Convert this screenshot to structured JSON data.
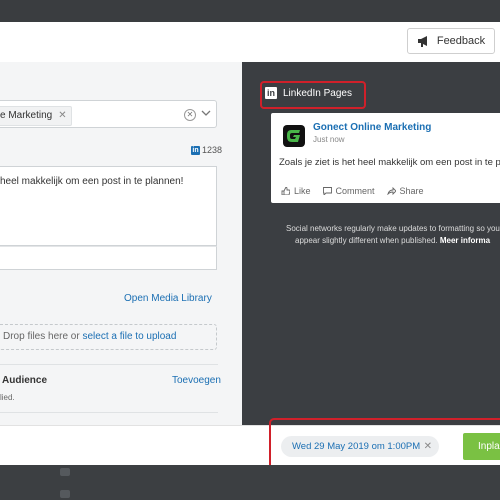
{
  "header": {
    "feedback_label": "Feedback"
  },
  "composer": {
    "selected_profile": "e Marketing",
    "linkedin_char_count": "1238",
    "post_text": "heel makkelijk om een post in te plannen!",
    "media_link": "Open Media Library",
    "dropzone_text": "Drop files here or ",
    "dropzone_link": "select a file to upload",
    "audience_label": "Audience",
    "audience_add": "Toevoegen",
    "audience_sub": "lied."
  },
  "preview": {
    "network_label": "LinkedIn Pages",
    "page_name": "Gonect Online Marketing",
    "time": "Just now",
    "text": "Zoals je ziet is het heel makkelijk om een post in te plann",
    "actions": [
      "Like",
      "Comment",
      "Share"
    ],
    "notice_line1": "Social networks regularly make updates to formatting so your",
    "notice_line2": "appear slightly different when published.",
    "notice_link": "Meer informa"
  },
  "footer": {
    "schedule_date": "Wed 29 May 2019 om 1:00PM",
    "schedule_button": "Inpla"
  },
  "colors": {
    "accent": "#1b6fb3",
    "highlight": "#d0202a",
    "primary_button": "#7ac143",
    "dark_panel": "#3b3e42"
  }
}
